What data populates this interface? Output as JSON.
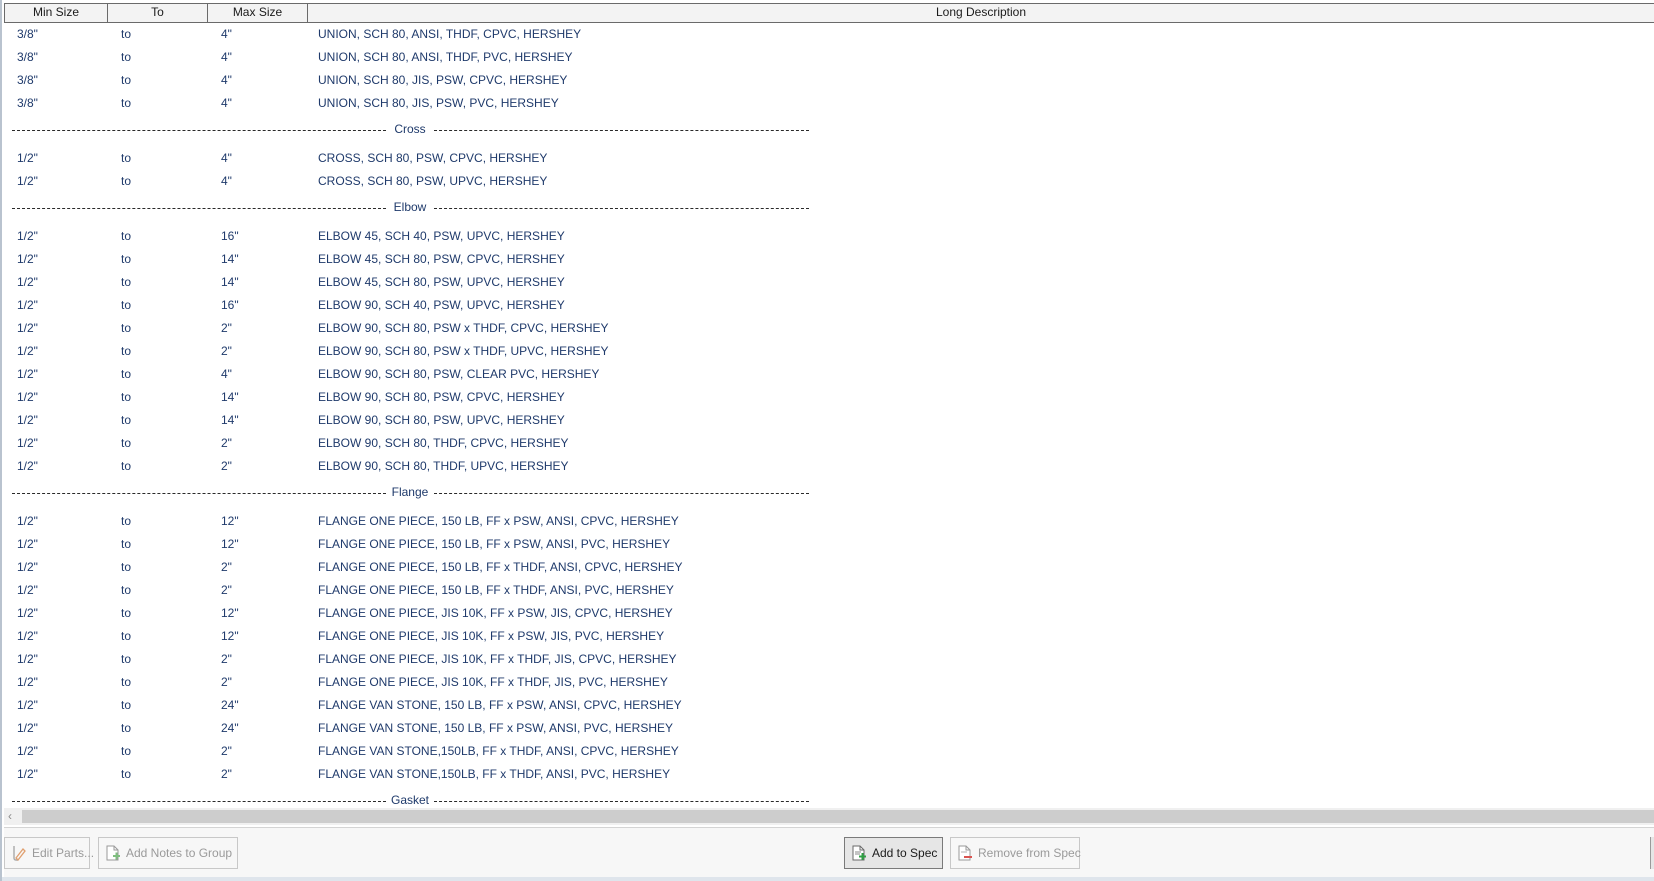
{
  "columns": {
    "min_size": "Min Size",
    "to": "To",
    "max_size": "Max Size",
    "long_description": "Long Description"
  },
  "rows_top": [
    {
      "min": "3/8\"",
      "to": "to",
      "max": "4\"",
      "desc": "UNION, SCH 80, ANSI, THDF, CPVC, HERSHEY"
    },
    {
      "min": "3/8\"",
      "to": "to",
      "max": "4\"",
      "desc": "UNION, SCH 80, ANSI, THDF, PVC, HERSHEY"
    },
    {
      "min": "3/8\"",
      "to": "to",
      "max": "4\"",
      "desc": "UNION, SCH 80, JIS, PSW, CPVC, HERSHEY"
    },
    {
      "min": "3/8\"",
      "to": "to",
      "max": "4\"",
      "desc": "UNION, SCH 80, JIS, PSW, PVC, HERSHEY"
    }
  ],
  "groups": [
    {
      "name": "Cross",
      "rows": [
        {
          "min": "1/2\"",
          "to": "to",
          "max": "4\"",
          "desc": "CROSS, SCH 80, PSW, CPVC, HERSHEY"
        },
        {
          "min": "1/2\"",
          "to": "to",
          "max": "4\"",
          "desc": "CROSS, SCH 80, PSW, UPVC, HERSHEY"
        }
      ]
    },
    {
      "name": "Elbow",
      "rows": [
        {
          "min": "1/2\"",
          "to": "to",
          "max": "16\"",
          "desc": "ELBOW 45, SCH 40, PSW, UPVC, HERSHEY"
        },
        {
          "min": "1/2\"",
          "to": "to",
          "max": "14\"",
          "desc": "ELBOW 45, SCH 80, PSW, CPVC, HERSHEY"
        },
        {
          "min": "1/2\"",
          "to": "to",
          "max": "14\"",
          "desc": "ELBOW 45, SCH 80, PSW, UPVC, HERSHEY"
        },
        {
          "min": "1/2\"",
          "to": "to",
          "max": "16\"",
          "desc": "ELBOW 90, SCH 40, PSW, UPVC, HERSHEY"
        },
        {
          "min": "1/2\"",
          "to": "to",
          "max": "2\"",
          "desc": "ELBOW 90, SCH 80, PSW x THDF, CPVC, HERSHEY"
        },
        {
          "min": "1/2\"",
          "to": "to",
          "max": "2\"",
          "desc": "ELBOW 90, SCH 80, PSW x THDF, UPVC, HERSHEY"
        },
        {
          "min": "1/2\"",
          "to": "to",
          "max": "4\"",
          "desc": "ELBOW 90, SCH 80, PSW, CLEAR PVC, HERSHEY"
        },
        {
          "min": "1/2\"",
          "to": "to",
          "max": "14\"",
          "desc": "ELBOW 90, SCH 80, PSW, CPVC, HERSHEY"
        },
        {
          "min": "1/2\"",
          "to": "to",
          "max": "14\"",
          "desc": "ELBOW 90, SCH 80, PSW, UPVC, HERSHEY"
        },
        {
          "min": "1/2\"",
          "to": "to",
          "max": "2\"",
          "desc": "ELBOW 90, SCH 80, THDF, CPVC, HERSHEY"
        },
        {
          "min": "1/2\"",
          "to": "to",
          "max": "2\"",
          "desc": "ELBOW 90, SCH 80, THDF, UPVC, HERSHEY"
        }
      ]
    },
    {
      "name": "Flange",
      "rows": [
        {
          "min": "1/2\"",
          "to": "to",
          "max": "12\"",
          "desc": "FLANGE ONE PIECE, 150 LB, FF x PSW, ANSI, CPVC, HERSHEY"
        },
        {
          "min": "1/2\"",
          "to": "to",
          "max": "12\"",
          "desc": "FLANGE ONE PIECE, 150 LB, FF x PSW, ANSI, PVC, HERSHEY"
        },
        {
          "min": "1/2\"",
          "to": "to",
          "max": "2\"",
          "desc": "FLANGE ONE PIECE, 150 LB, FF x THDF, ANSI, CPVC, HERSHEY"
        },
        {
          "min": "1/2\"",
          "to": "to",
          "max": "2\"",
          "desc": "FLANGE ONE PIECE, 150 LB, FF x THDF, ANSI, PVC, HERSHEY"
        },
        {
          "min": "1/2\"",
          "to": "to",
          "max": "12\"",
          "desc": "FLANGE ONE PIECE, JIS 10K, FF x PSW, JIS, CPVC, HERSHEY"
        },
        {
          "min": "1/2\"",
          "to": "to",
          "max": "12\"",
          "desc": "FLANGE ONE PIECE, JIS 10K, FF x PSW, JIS, PVC, HERSHEY"
        },
        {
          "min": "1/2\"",
          "to": "to",
          "max": "2\"",
          "desc": "FLANGE ONE PIECE, JIS 10K, FF x THDF, JIS, CPVC, HERSHEY"
        },
        {
          "min": "1/2\"",
          "to": "to",
          "max": "2\"",
          "desc": "FLANGE ONE PIECE, JIS 10K, FF x THDF, JIS, PVC, HERSHEY"
        },
        {
          "min": "1/2\"",
          "to": "to",
          "max": "24\"",
          "desc": "FLANGE VAN STONE, 150 LB, FF x PSW, ANSI, CPVC, HERSHEY"
        },
        {
          "min": "1/2\"",
          "to": "to",
          "max": "24\"",
          "desc": "FLANGE VAN STONE, 150 LB, FF x PSW, ANSI, PVC, HERSHEY"
        },
        {
          "min": "1/2\"",
          "to": "to",
          "max": "2\"",
          "desc": "FLANGE VAN STONE,150LB, FF x THDF, ANSI, CPVC, HERSHEY"
        },
        {
          "min": "1/2\"",
          "to": "to",
          "max": "2\"",
          "desc": "FLANGE VAN STONE,150LB, FF x THDF, ANSI, PVC, HERSHEY"
        }
      ]
    },
    {
      "name": "Gasket",
      "rows": []
    }
  ],
  "toolbar": {
    "edit_parts": "Edit Parts...",
    "add_notes": "Add Notes to Group",
    "add_to_spec": "Add to Spec",
    "remove_from_spec": "Remove from Spec"
  },
  "icons": {
    "edit_parts": "edit-parts-icon",
    "add_notes": "add-note-icon",
    "add_to_spec": "add-document-icon",
    "remove_from_spec": "remove-document-icon"
  },
  "colors": {
    "text": "#1f3a6b",
    "header_bg": "#f3f3f3",
    "add_icon": "#2ea043",
    "remove_icon": "#d9534f"
  }
}
